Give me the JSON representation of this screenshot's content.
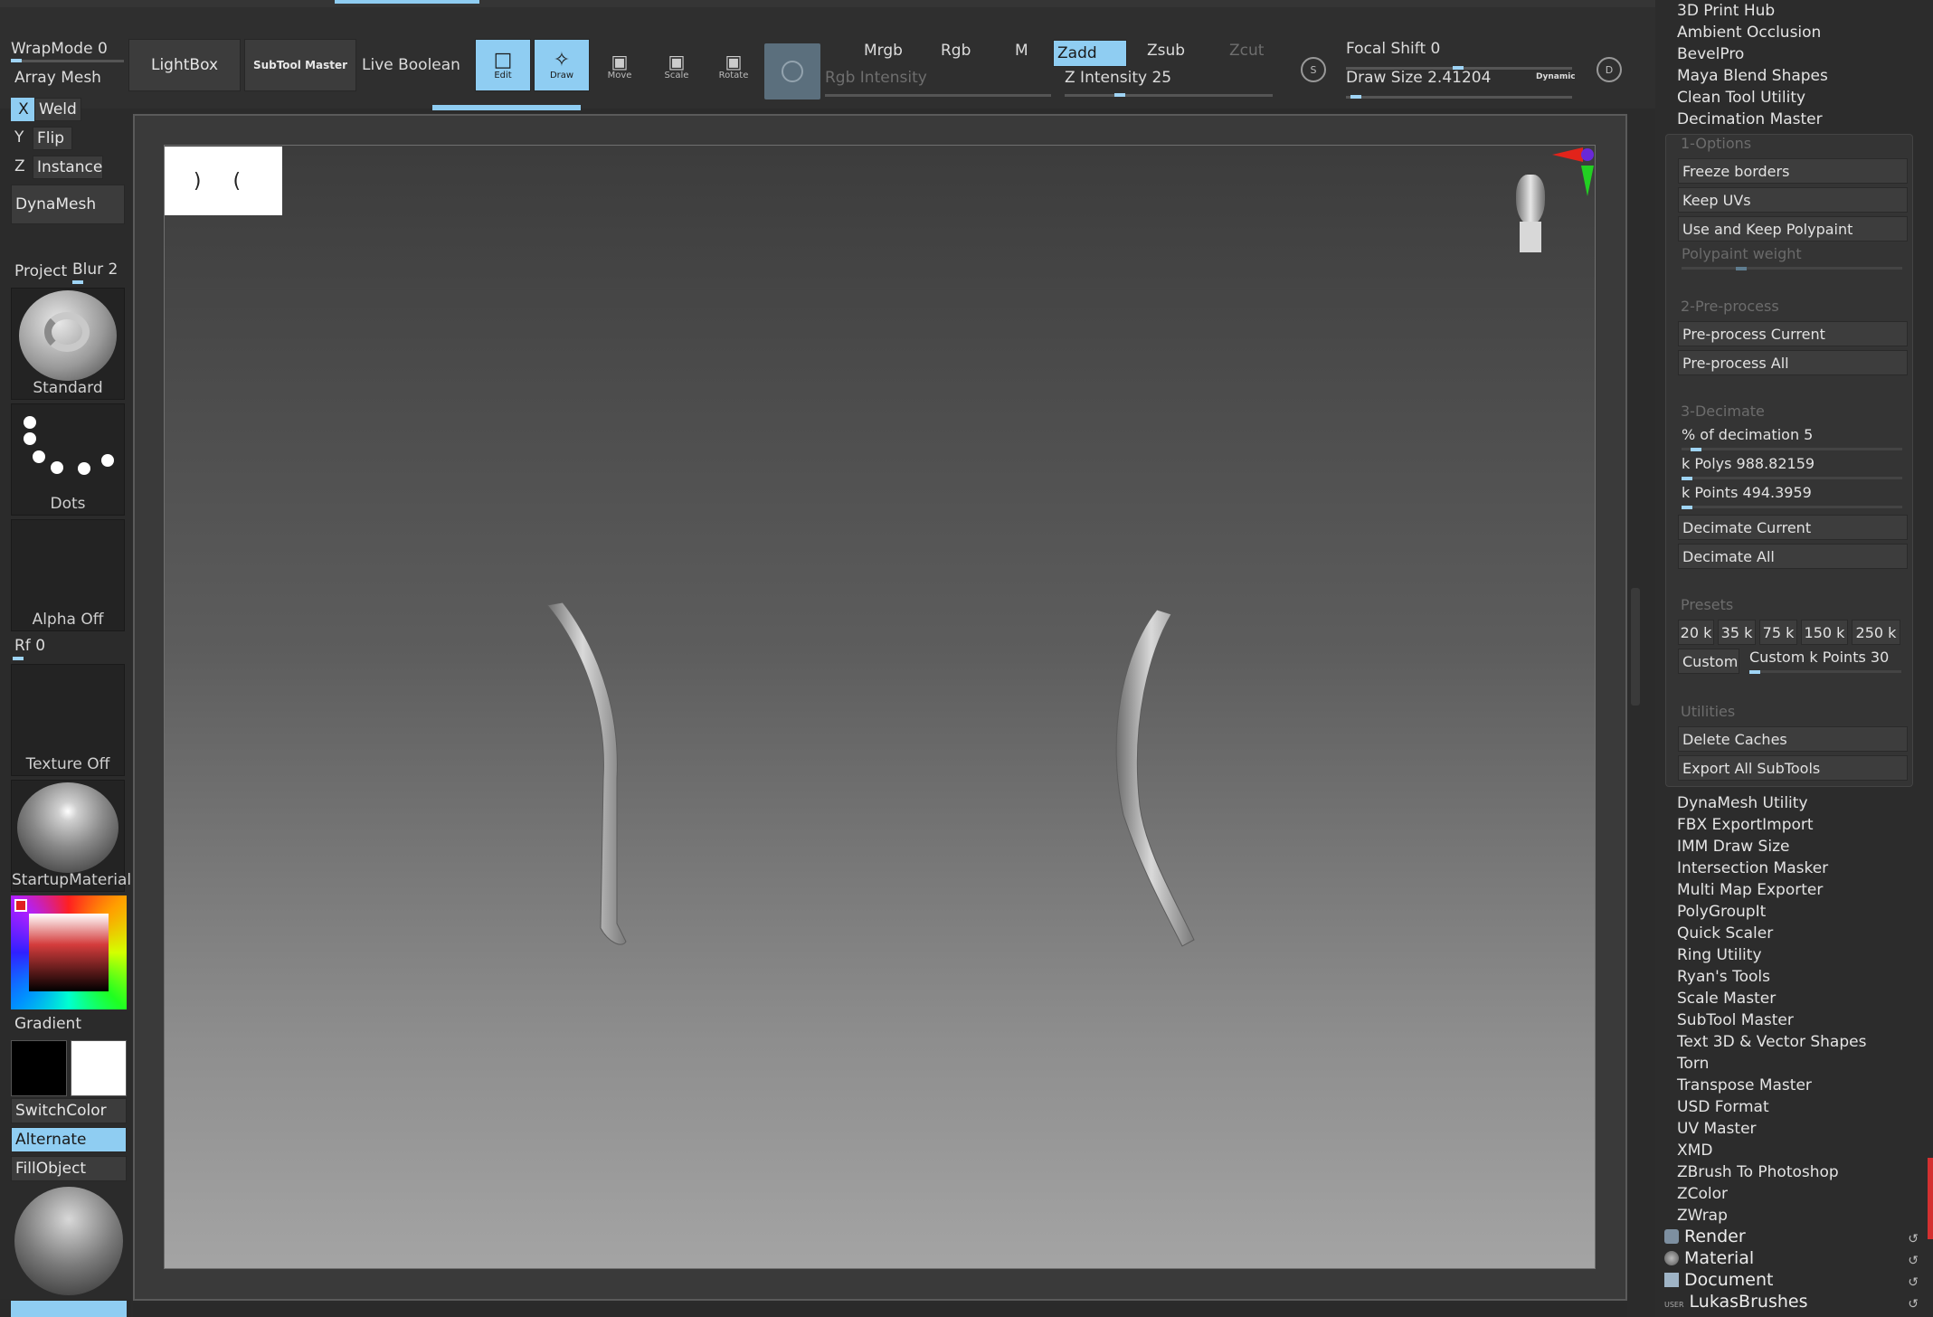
{
  "toolbar": {
    "wrap_mode": "WrapMode 0",
    "array_mesh": "Array Mesh",
    "lightbox": "LightBox",
    "subtool_master": "SubTool Master",
    "live_boolean": "Live Boolean",
    "edit": "Edit",
    "draw": "Draw",
    "move": "Move",
    "scale": "Scale",
    "rotate": "Rotate",
    "mrgb": "Mrgb",
    "rgb": "Rgb",
    "m": "M",
    "zadd": "Zadd",
    "zsub": "Zsub",
    "zcut": "Zcut",
    "rgb_intensity": "Rgb Intensity",
    "z_intensity": "Z Intensity 25",
    "focal_shift": "Focal Shift 0",
    "draw_size": "Draw Size 2.41204",
    "dynamic": "Dynamic",
    "z_intensity_level": 0.25,
    "draw_size_level": 0.02
  },
  "left": {
    "x": "X",
    "weld": "Weld",
    "y": "Y",
    "flip": "Flip",
    "z": "Z",
    "instance": "Instance",
    "dynamesh": "DynaMesh",
    "project": "Project",
    "blur": "Blur 2",
    "brush": "Standard",
    "stroke": "Dots",
    "alpha": "Alpha Off",
    "rf": "Rf 0",
    "texture": "Texture Off",
    "material": "StartupMaterial",
    "gradient": "Gradient",
    "switch_color": "SwitchColor",
    "alternate": "Alternate",
    "fill_object": "FillObject"
  },
  "right": {
    "plugins_top": [
      "3D Print Hub",
      "Ambient Occlusion",
      "BevelPro",
      "Maya Blend Shapes",
      "Clean Tool Utility"
    ],
    "decimation_master": "Decimation Master",
    "sec_options": "1-Options",
    "freeze_borders": "Freeze borders",
    "keep_uvs": "Keep UVs",
    "use_keep_polypaint": "Use and Keep Polypaint",
    "polypaint_weight": "Polypaint weight",
    "sec_preprocess": "2-Pre-process",
    "preprocess_current": "Pre-process Current",
    "preprocess_all": "Pre-process All",
    "sec_decimate": "3-Decimate",
    "pct_decimation": "% of decimation 5",
    "k_polys": "k Polys 988.82159",
    "k_points": "k Points 494.3959",
    "decimate_current": "Decimate Current",
    "decimate_all": "Decimate All",
    "sec_presets": "Presets",
    "presets": [
      "20 k",
      "35 k",
      "75 k",
      "150 k",
      "250 k"
    ],
    "custom": "Custom",
    "custom_k_points": "Custom k Points 30",
    "sec_utilities": "Utilities",
    "delete_caches": "Delete Caches",
    "export_all": "Export All SubTools",
    "plugins_bottom": [
      "DynaMesh Utility",
      "FBX ExportImport",
      "IMM Draw Size",
      "Intersection Masker",
      "Multi Map Exporter",
      "PolyGroupIt",
      "Quick Scaler",
      "Ring Utility",
      "Ryan's Tools",
      "Scale Master",
      "SubTool Master",
      "Text 3D & Vector Shapes",
      "Torn",
      "Transpose Master",
      "USD Format",
      "UV Master",
      "XMD",
      "ZBrush To Photoshop",
      "ZColor",
      "ZWrap"
    ],
    "render": "Render",
    "material": "Material",
    "document": "Document",
    "user_badge": "USER",
    "lukas_brushes": "LukasBrushes"
  },
  "canvas": {
    "preview_text": ") ("
  },
  "colors": {
    "accent": "#8fcdf2",
    "panel": "#2f2f2f",
    "canvas_top": "#3c3c3c",
    "canvas_bottom": "#a4a4a4"
  }
}
